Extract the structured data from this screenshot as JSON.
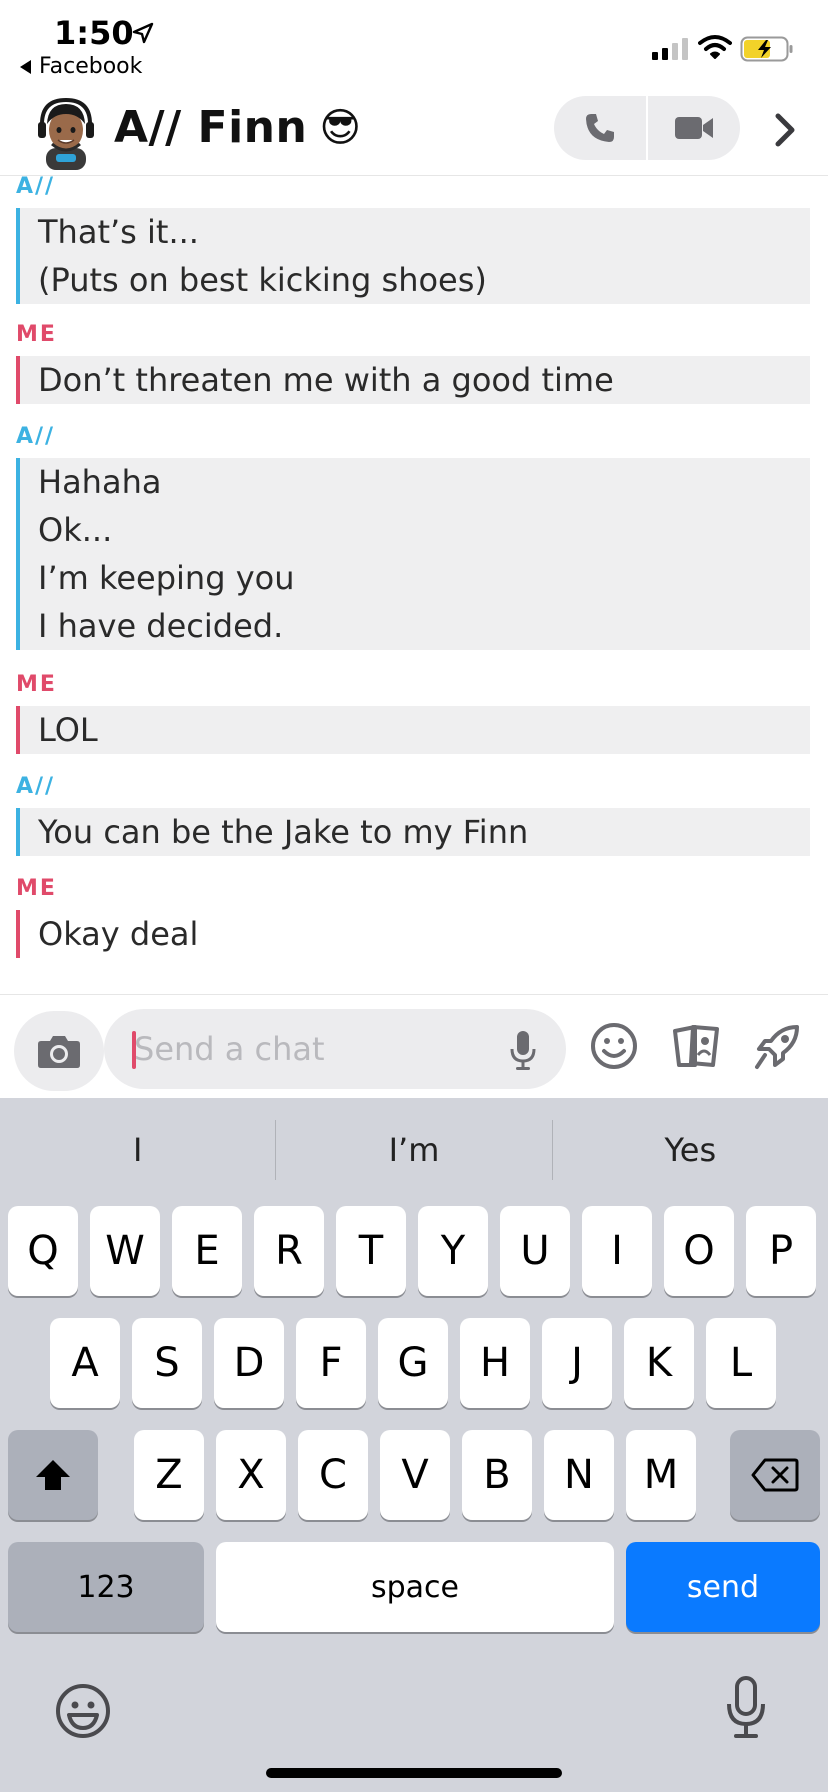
{
  "status_bar": {
    "time": "1:50",
    "back_app": "Facebook"
  },
  "header": {
    "title": "A// Finn",
    "title_emoji": "😎"
  },
  "messages": [
    {
      "sender": "A//",
      "from_me": false,
      "lines": [
        "That’s it...",
        "(Puts on best kicking shoes)"
      ]
    },
    {
      "sender": "ME",
      "from_me": true,
      "lines": [
        "Don’t threaten me with a good time"
      ]
    },
    {
      "sender": "A//",
      "from_me": false,
      "lines": [
        "Hahaha",
        "Ok...",
        "I’m keeping you",
        "I have decided."
      ]
    },
    {
      "sender": "ME",
      "from_me": true,
      "lines": [
        "LOL"
      ]
    },
    {
      "sender": "A//",
      "from_me": false,
      "lines": [
        "You can be the Jake to my Finn"
      ]
    },
    {
      "sender": "ME",
      "from_me": true,
      "lines": [
        "Okay deal"
      ]
    }
  ],
  "composer": {
    "placeholder": "Send a chat",
    "value": ""
  },
  "keyboard": {
    "suggestions": [
      "I",
      "I’m",
      "Yes"
    ],
    "row1": [
      "Q",
      "W",
      "E",
      "R",
      "T",
      "Y",
      "U",
      "I",
      "O",
      "P"
    ],
    "row2": [
      "A",
      "S",
      "D",
      "F",
      "G",
      "H",
      "J",
      "K",
      "L"
    ],
    "row3": [
      "Z",
      "X",
      "C",
      "V",
      "B",
      "N",
      "M"
    ],
    "numbers_label": "123",
    "space_label": "space",
    "send_label": "send"
  },
  "colors": {
    "them_accent": "#3cb2e2",
    "me_accent": "#e04a6a",
    "send_key": "#0a7aff"
  },
  "icons": [
    "location-arrow-icon",
    "signal-icon",
    "wifi-icon",
    "battery-charging-icon",
    "bitmoji-avatar",
    "phone-icon",
    "video-camera-icon",
    "chevron-right-icon",
    "camera-icon",
    "microphone-icon",
    "smiley-icon",
    "cards-icon",
    "rocket-icon",
    "shift-icon",
    "backspace-icon"
  ]
}
